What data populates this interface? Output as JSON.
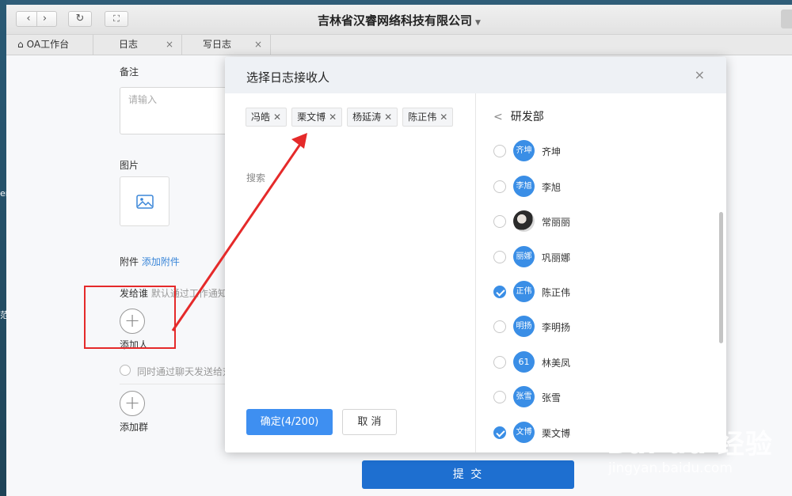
{
  "window": {
    "title": "吉林省汉睿网络科技有限公司",
    "nav": {
      "back": "‹",
      "forward": "›",
      "refresh": "↻",
      "fullscreen": "⛶"
    }
  },
  "tabs": [
    {
      "label": "OA工作台",
      "closable": false
    },
    {
      "label": "日志",
      "closable": true
    },
    {
      "label": "写日志",
      "closable": true
    }
  ],
  "form": {
    "remark_label": "备注",
    "remark_placeholder": "请输入",
    "image_label": "图片",
    "attachment_label": "附件",
    "attachment_link": "添加附件",
    "send_to_label": "发给谁",
    "send_to_hint": "默认通过工作通知",
    "add_person_label": "添加人",
    "chat_sync_text": "同时通过聊天发送给对",
    "add_group_label": "添加群",
    "submit_label": "提 交"
  },
  "dialog": {
    "title": "选择日志接收人",
    "close": "×",
    "selected": [
      "冯皓",
      "栗文博",
      "杨延涛",
      "陈正伟"
    ],
    "search_placeholder": "搜索",
    "confirm_label": "确定(4/200)",
    "cancel_label": "取 消",
    "department": "研发部",
    "members": [
      {
        "name": "齐坤",
        "avatar": "齐坤",
        "checked": false
      },
      {
        "name": "李旭",
        "avatar": "李旭",
        "checked": false
      },
      {
        "name": "常丽丽",
        "avatar": "",
        "checked": false,
        "photo": true
      },
      {
        "name": "巩丽娜",
        "avatar": "丽娜",
        "checked": false
      },
      {
        "name": "陈正伟",
        "avatar": "正伟",
        "checked": true
      },
      {
        "name": "李明扬",
        "avatar": "明扬",
        "checked": false
      },
      {
        "name": "林美凤",
        "avatar": "61",
        "checked": false
      },
      {
        "name": "张雪",
        "avatar": "张雪",
        "checked": false
      },
      {
        "name": "栗文博",
        "avatar": "文博",
        "checked": true
      }
    ]
  },
  "colors": {
    "accent": "#3e8ff1",
    "submit": "#1e6fd0",
    "annotation": "#e52a2a"
  },
  "watermark": {
    "brand": "Bai du 经验",
    "url": "jingyan.baidu.com"
  },
  "desktop": {
    "glyph1": "er",
    "glyph2": "范"
  }
}
